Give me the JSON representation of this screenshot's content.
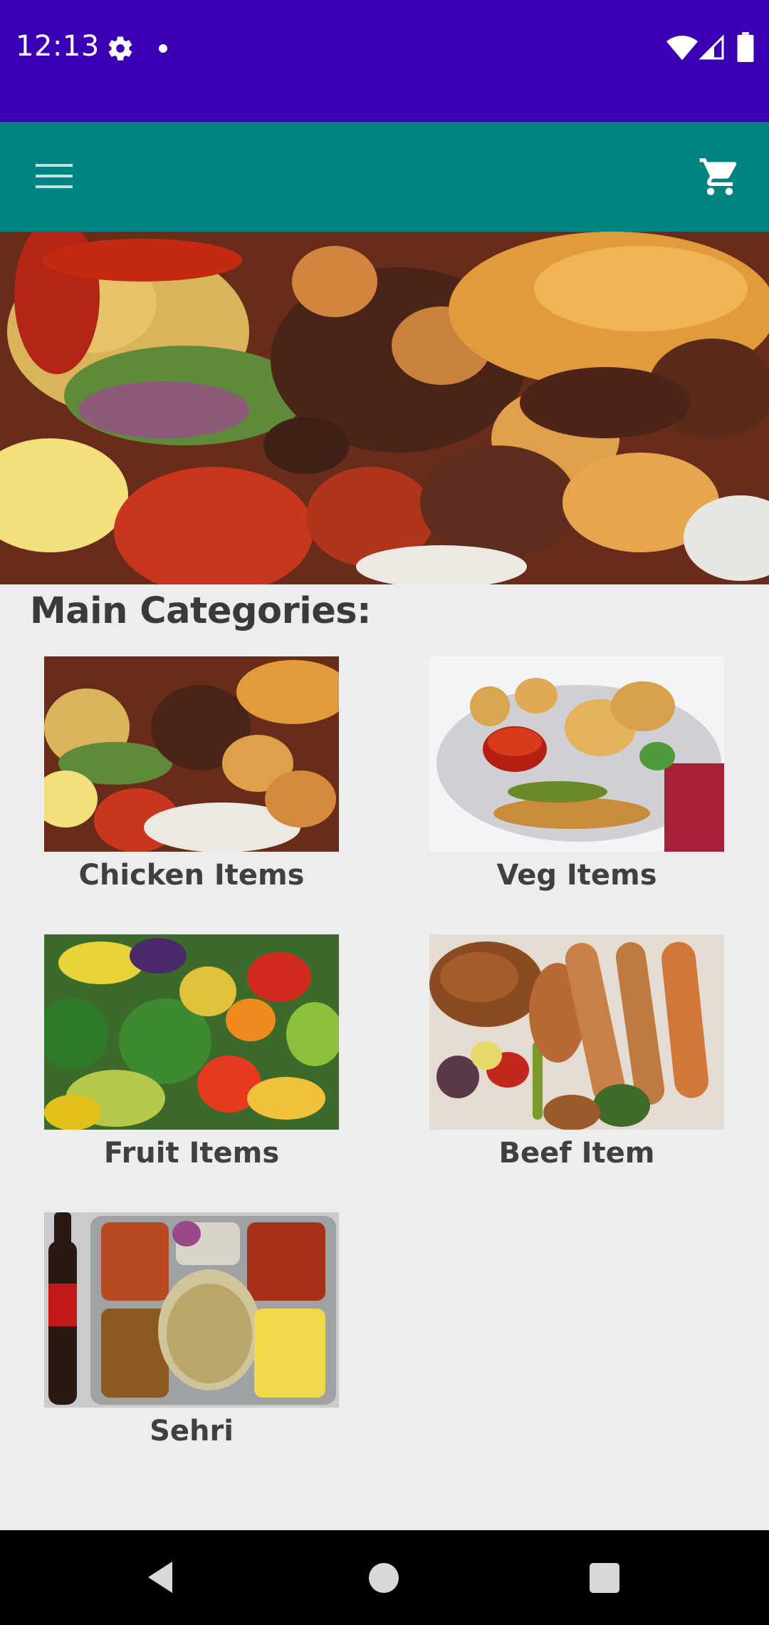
{
  "status_bar": {
    "time": "12:13",
    "icons": [
      "gear-icon",
      "notification-dot-icon",
      "wifi-icon",
      "signal-icon",
      "battery-icon"
    ],
    "background": "#3c00b4"
  },
  "app_bar": {
    "background": "#008382",
    "icons": [
      "menu-icon",
      "cart-icon"
    ]
  },
  "hero": {
    "subject": "grilled kebab platter"
  },
  "main": {
    "title": "Main Categories:",
    "categories": [
      {
        "label": "Chicken Items",
        "image": "kebab-platter"
      },
      {
        "label": "Veg Items",
        "image": "pakora-plate"
      },
      {
        "label": "Fruit Items",
        "image": "fruit-assortment"
      },
      {
        "label": "Beef Item",
        "image": "bbq-platter"
      },
      {
        "label": "Sehri",
        "image": "meal-thali"
      }
    ]
  },
  "nav_bar": {
    "icons": [
      "back-icon",
      "home-icon",
      "recents-icon"
    ]
  }
}
